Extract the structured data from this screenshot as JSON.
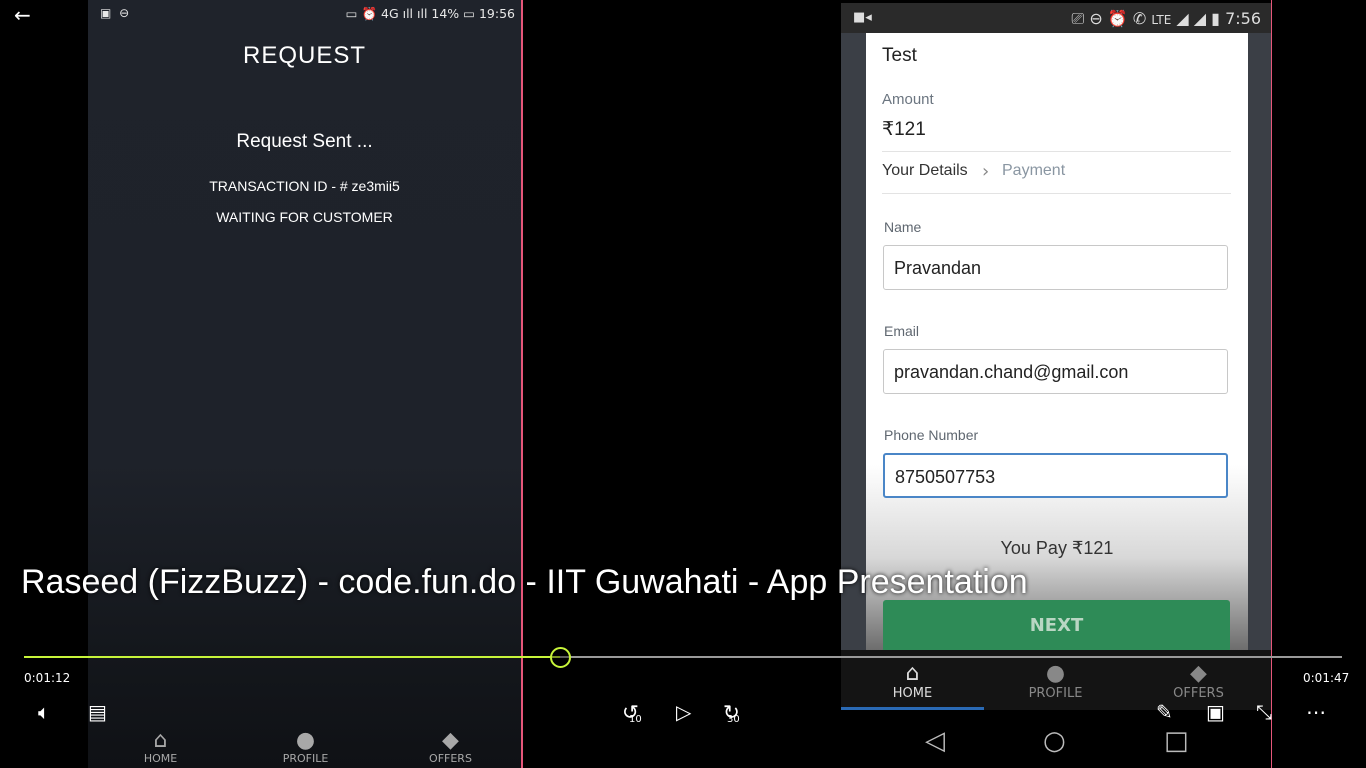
{
  "left_phone": {
    "status_time": "19:56",
    "status_battery": "14%",
    "status_network": "4G",
    "title": "REQUEST",
    "message": "Request Sent ...",
    "transaction": "TRANSACTION ID - # ze3mii5",
    "waiting": "WAITING FOR CUSTOMER",
    "nav": [
      {
        "label": "HOME",
        "icon": "home-icon"
      },
      {
        "label": "PROFILE",
        "icon": "profile-icon"
      },
      {
        "label": "OFFERS",
        "icon": "tag-icon"
      }
    ]
  },
  "right_phone": {
    "status_time": "7:56",
    "status_network": "LTE",
    "purpose_value": "Test",
    "amount_label": "Amount",
    "amount_value": "₹121",
    "steps": {
      "current": "Your Details",
      "next": "Payment"
    },
    "name_label": "Name",
    "name_value": "Pravandan",
    "email_label": "Email",
    "email_value": "pravandan.chand@gmail.con",
    "phone_label": "Phone Number",
    "phone_value": "8750507753",
    "you_pay": "You Pay ₹121",
    "next_button": "NEXT",
    "nav": [
      {
        "label": "HOME",
        "icon": "home-icon"
      },
      {
        "label": "PROFILE",
        "icon": "profile-icon"
      },
      {
        "label": "OFFERS",
        "icon": "tag-icon"
      }
    ]
  },
  "video": {
    "title": "Raseed (FizzBuzz) - code.fun.do - IIT Guwahati - App Presentation",
    "elapsed": "0:01:12",
    "total": "0:01:47",
    "progress": 0.4065,
    "skip_back": "10",
    "skip_forward": "30"
  },
  "colors": {
    "progress": "#c8f53a",
    "divider_lines": "#e6577a",
    "next_button": "#2e8b57",
    "active_nav": "#2a6ab5"
  }
}
